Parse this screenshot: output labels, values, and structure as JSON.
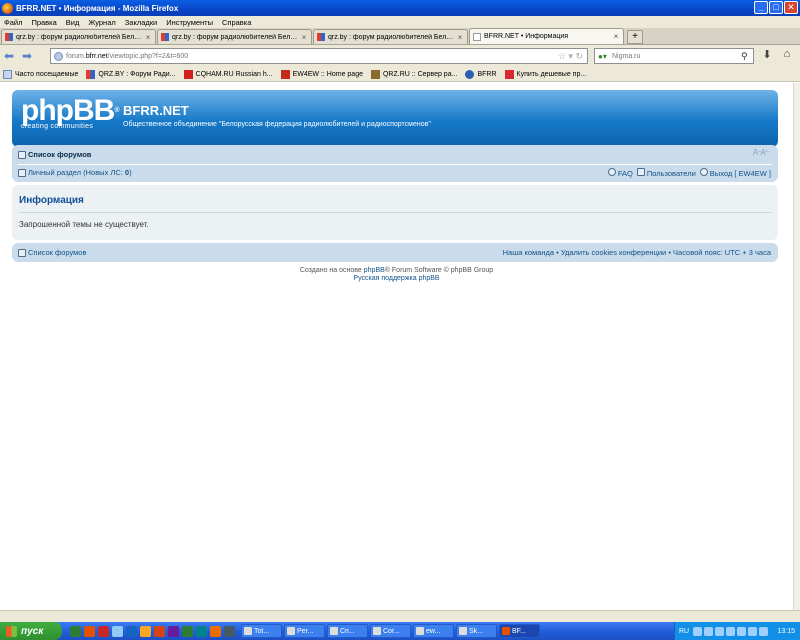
{
  "window": {
    "title": "BFRR.NET • Информация - Mozilla Firefox"
  },
  "menu": [
    "Файл",
    "Правка",
    "Вид",
    "Журнал",
    "Закладки",
    "Инструменты",
    "Справка"
  ],
  "tabs": [
    {
      "label": "qrz.by : форум радиолюбителей Белар...",
      "icon": "qrz-favicon"
    },
    {
      "label": "qrz.by : форум радиолюбителей Белар...",
      "icon": "qrz-favicon"
    },
    {
      "label": "qrz.by : форум радиолюбителей Белар...",
      "icon": "qrz-favicon"
    },
    {
      "label": "BFRR.NET • Информация",
      "icon": "blank-page-icon",
      "active": true
    }
  ],
  "nav": {
    "url_host": "forum.bfrr.net",
    "url_path": "/viewtopic.php?f=2&t=600",
    "url_prefix": "forum.",
    "url_domain": "bfrr.net",
    "search_placeholder": "Nigma.ru"
  },
  "bookmarks": [
    {
      "label": "Часто посещаемые"
    },
    {
      "label": "QRZ.BY : Форум Ради..."
    },
    {
      "label": "CQHAM.RU Russian h..."
    },
    {
      "label": "EW4EW :: Home page"
    },
    {
      "label": "QRZ.RU :: Сервер ра..."
    },
    {
      "label": "BFRR"
    },
    {
      "label": "Купить дешевые пр..."
    }
  ],
  "forum": {
    "logo_text": "phpBB",
    "logo_mark": "®",
    "logo_tagline": "creating communities",
    "site_name": "BFRR.NET",
    "site_description": "Общественное объединение \"Белорусская федерация радиолюбителей и радиоспортсменов\"",
    "forum_list": "Список форумов",
    "font_size": "A⁻A⁺",
    "pm_prefix": "Личный раздел (Новых ЛС: ",
    "pm_count": "0",
    "pm_suffix": ")",
    "faq": "FAQ",
    "users": "Пользователи",
    "logout": "Выход [ EW4EW ]",
    "info_title": "Информация",
    "info_message": "Запрошенной темы не существует.",
    "footer_forum_list": "Список форумов",
    "footer_team": "Наша команда",
    "footer_sep": " • ",
    "footer_cookies": "Удалить cookies конференции",
    "footer_tz": "Часовой пояс: UTC + 3 часа",
    "powered_prefix": "Создано на основе ",
    "powered_link": "phpBB",
    "powered_suffix": "® Forum Software © phpBB Group",
    "ru_support": "Русская поддержка phpBB"
  },
  "taskbar": {
    "start": "пуск",
    "tasks": [
      "Tot...",
      "Per...",
      "Сп...",
      "Cor...",
      "ew...",
      "Sk...",
      "BF...",
      ""
    ],
    "lang": "RU",
    "clock": "13:15"
  },
  "colors": {
    "header_blue": "#1579c8",
    "panel_blue": "#cadceb",
    "info_bg": "#ecf1f3",
    "link": "#105289",
    "title": "#115098"
  }
}
